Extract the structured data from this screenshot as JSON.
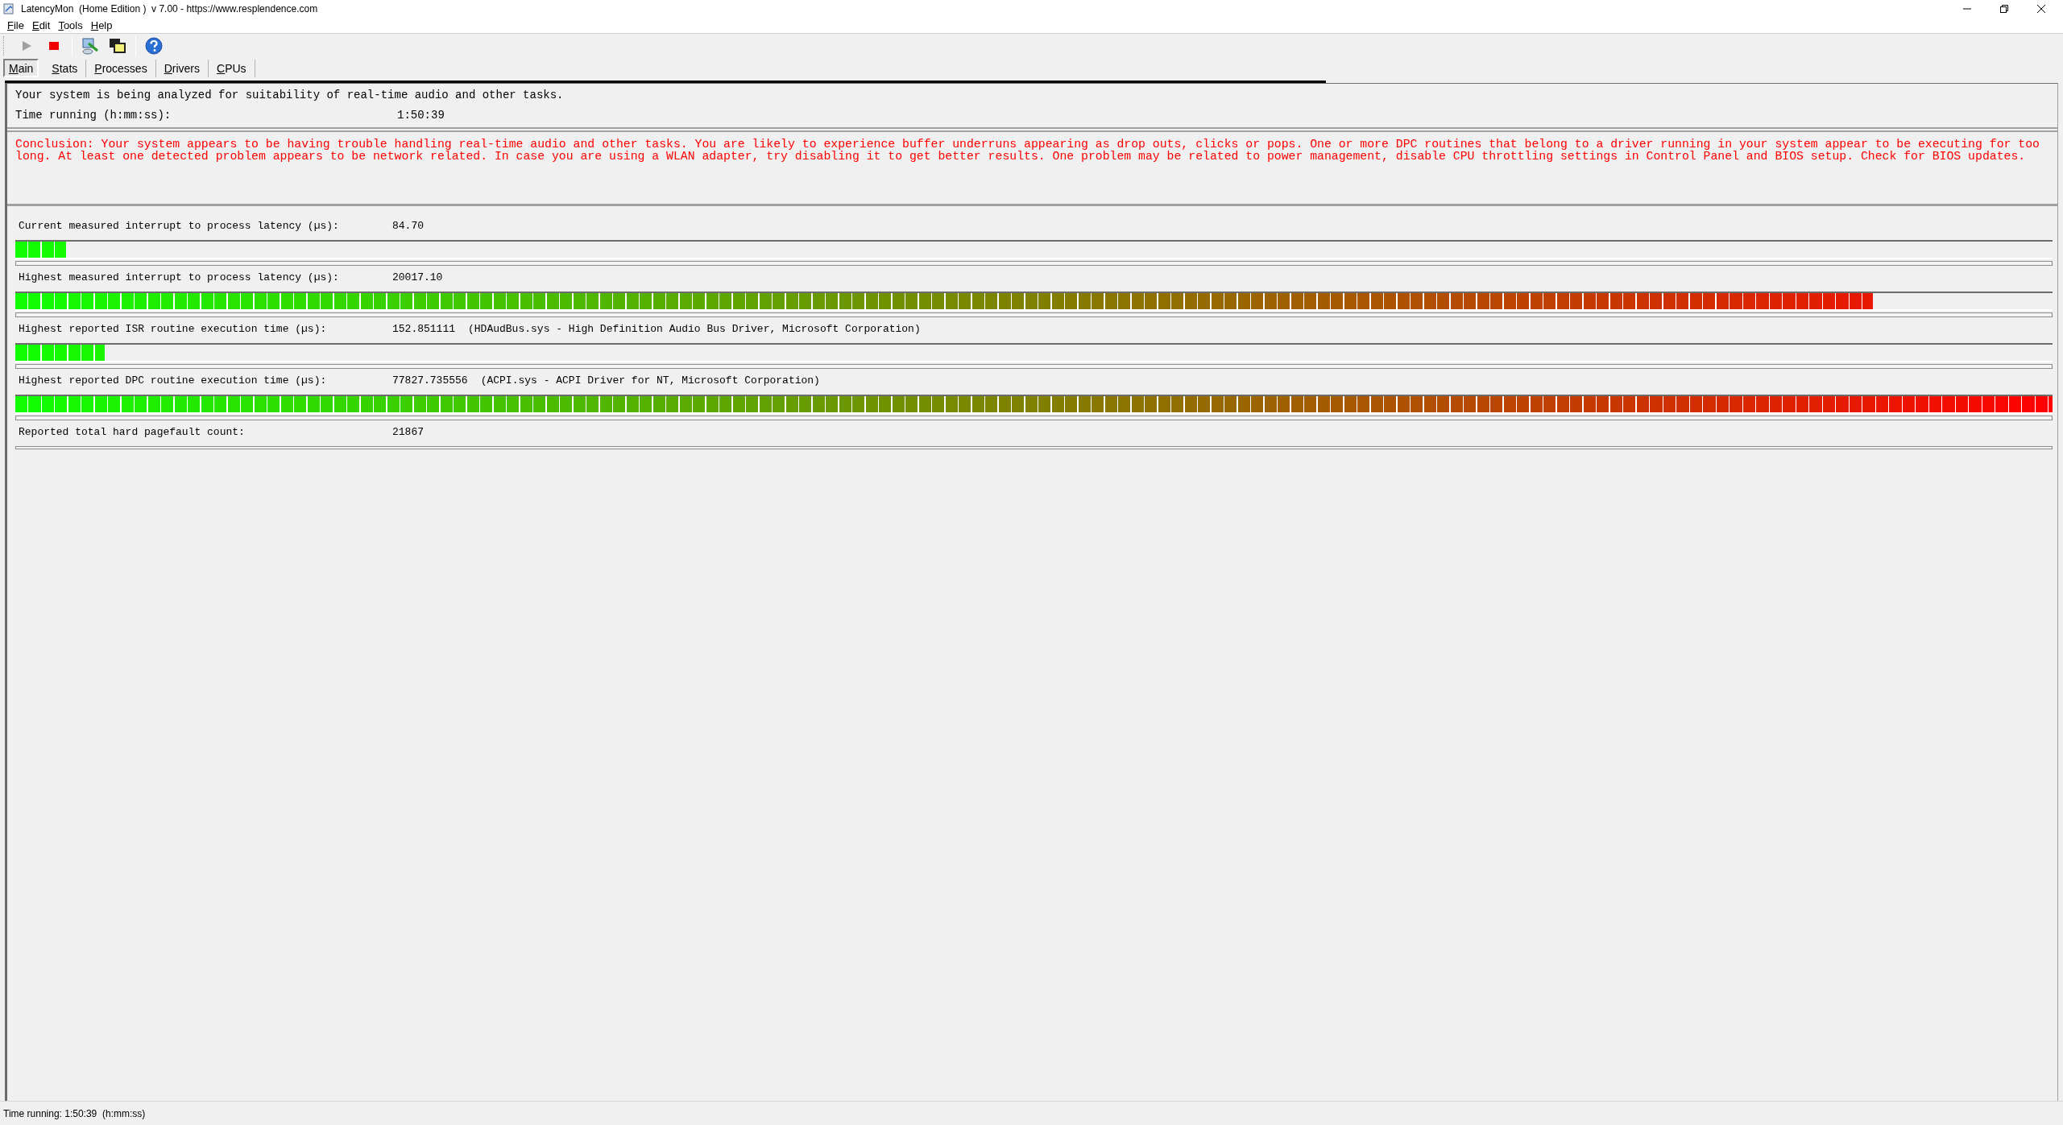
{
  "window": {
    "title": "LatencyMon  (Home Edition )  v 7.00 - https://www.resplendence.com"
  },
  "menu": [
    "File",
    "Edit",
    "Tools",
    "Help"
  ],
  "toolbar": [
    {
      "kind": "start",
      "disabled": true
    },
    {
      "kind": "stop",
      "disabled": false
    },
    {
      "kind": "separator"
    },
    {
      "kind": "monitor"
    },
    {
      "kind": "windows"
    },
    {
      "kind": "separator"
    },
    {
      "kind": "help"
    }
  ],
  "tabs": [
    {
      "label": "Main",
      "selected": true
    },
    {
      "label": "Stats",
      "selected": false
    },
    {
      "label": "Processes",
      "selected": false
    },
    {
      "label": "Drivers",
      "selected": false
    },
    {
      "label": "CPUs",
      "selected": false
    }
  ],
  "analysis": {
    "message": "Your system is being analyzed for suitability of real-time audio and other tasks.",
    "time_label": "Time running (h:mm:ss):",
    "time_value": "1:50:39"
  },
  "conclusion": "Conclusion: Your system appears to be having trouble handling real-time audio and other tasks. You are likely to experience buffer underruns appearing as drop outs, clicks or pops. One or more DPC routines that belong to a driver running in your system appear to be executing for too long. At least one detected problem appears to be network related. In case you are using a WLAN adapter, try disabling it to get better results. One problem may be related to power management, disable CPU throttling settings in Control Panel and BIOS setup. Check for BIOS updates.",
  "metrics": [
    {
      "kind": "meter",
      "label": "Current measured interrupt to process latency (µs):",
      "value": "84.70",
      "level": 0.025
    },
    {
      "kind": "meter",
      "label": "Highest measured interrupt to process latency (µs):",
      "value": "20017.10",
      "level": 0.912
    },
    {
      "kind": "meter",
      "label": "Highest reported ISR routine execution time (µs):",
      "value": "152.851111",
      "detail": "(HDAudBus.sys - High Definition Audio Bus Driver, Microsoft Corporation)",
      "level": 0.044
    },
    {
      "kind": "meter",
      "label": "Highest reported DPC routine execution time (µs):",
      "value": "77827.735556",
      "detail": "(ACPI.sys - ACPI Driver for NT, Microsoft Corporation)",
      "level": 1.0
    },
    {
      "kind": "count",
      "label": "Reported total hard pagefault count:",
      "value": "21867"
    }
  ],
  "status_bar": "Time running: 1:50:39  (h:mm:ss)"
}
